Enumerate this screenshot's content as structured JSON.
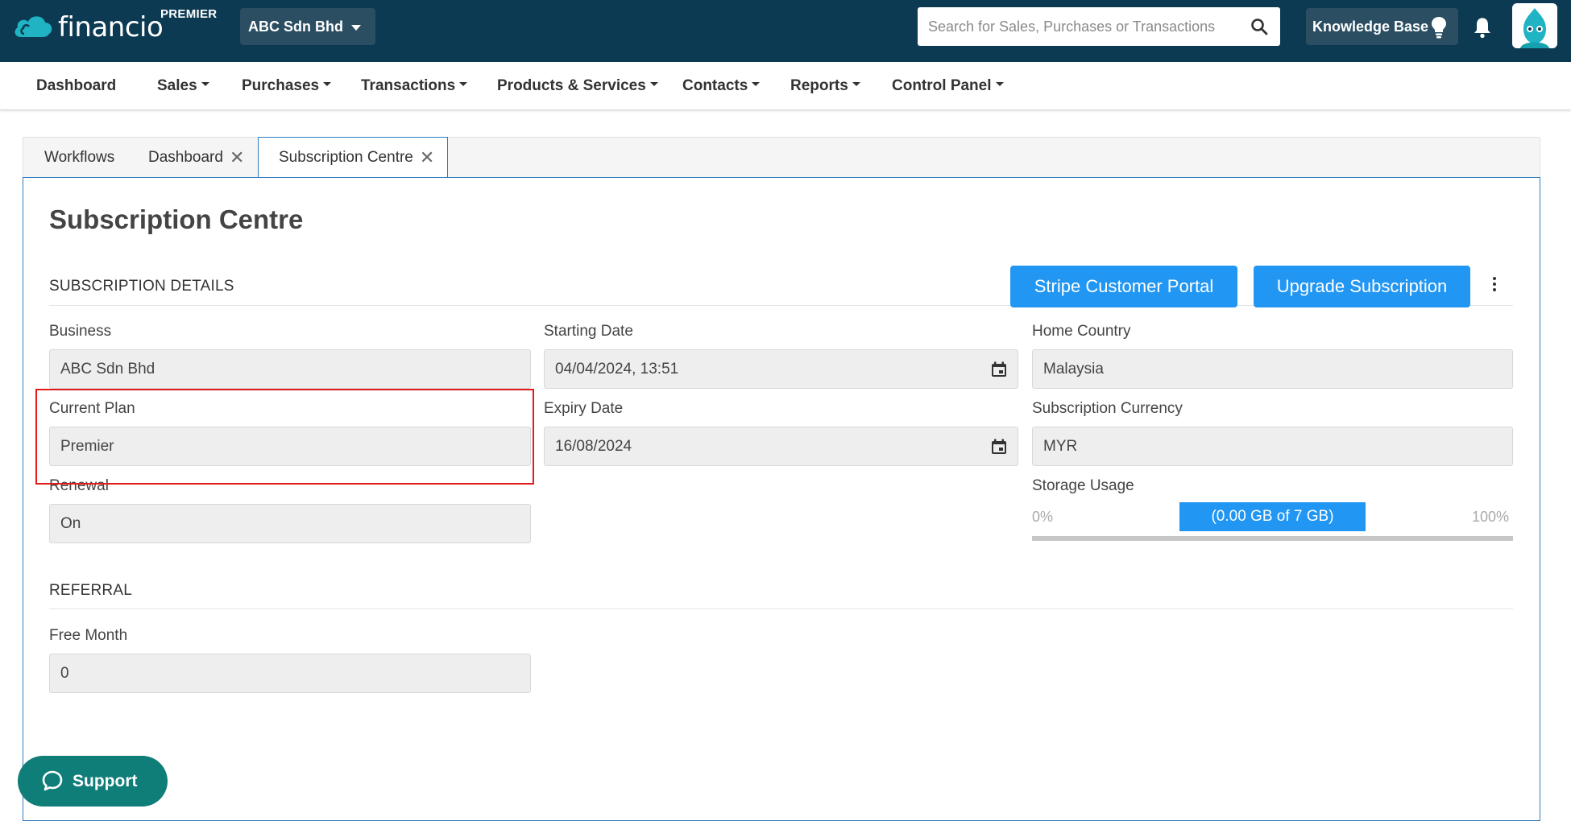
{
  "header": {
    "logo_text": "financio",
    "plan_badge": "PREMIER",
    "business_name": "ABC Sdn Bhd",
    "search_placeholder": "Search for Sales, Purchases or Transactions",
    "knowledge_base_label": "Knowledge Base",
    "colors": {
      "bar": "#0c3a52",
      "button": "#2b4e62",
      "brand_teal": "#1fb3c4"
    }
  },
  "nav": {
    "items": [
      {
        "label": "Dashboard",
        "dropdown": false
      },
      {
        "label": "Sales",
        "dropdown": true
      },
      {
        "label": "Purchases",
        "dropdown": true
      },
      {
        "label": "Transactions",
        "dropdown": true
      },
      {
        "label": "Products & Services",
        "dropdown": true
      },
      {
        "label": "Contacts",
        "dropdown": true
      },
      {
        "label": "Reports",
        "dropdown": true
      },
      {
        "label": "Control Panel",
        "dropdown": true
      }
    ]
  },
  "tabs": [
    {
      "label": "Workflows",
      "closable": false,
      "active": false
    },
    {
      "label": "Dashboard",
      "closable": true,
      "active": false
    },
    {
      "label": "Subscription Centre",
      "closable": true,
      "active": true
    }
  ],
  "page": {
    "title": "Subscription Centre",
    "subscription_section": "SUBSCRIPTION DETAILS",
    "stripe_button": "Stripe Customer Portal",
    "upgrade_button": "Upgrade Subscription",
    "fields": {
      "business": {
        "label": "Business",
        "value": "ABC Sdn Bhd"
      },
      "current_plan": {
        "label": "Current Plan",
        "value": "Premier"
      },
      "renewal": {
        "label": "Renewal",
        "value": "On"
      },
      "starting_date": {
        "label": "Starting Date",
        "value": "04/04/2024, 13:51"
      },
      "expiry_date": {
        "label": "Expiry Date",
        "value": "16/08/2024"
      },
      "home_country": {
        "label": "Home Country",
        "value": "Malaysia"
      },
      "subscription_currency": {
        "label": "Subscription Currency",
        "value": "MYR"
      }
    },
    "storage": {
      "label": "Storage Usage",
      "min_label": "0%",
      "max_label": "100%",
      "bar_text": "(0.00 GB of 7 GB)",
      "used_fraction": 0
    },
    "referral_section": "REFERRAL",
    "free_month": {
      "label": "Free Month",
      "value": "0"
    },
    "accent_color": "#2196f3",
    "highlight_color": "#e01c1c"
  },
  "support": {
    "label": "Support",
    "color": "#0f7d78"
  }
}
